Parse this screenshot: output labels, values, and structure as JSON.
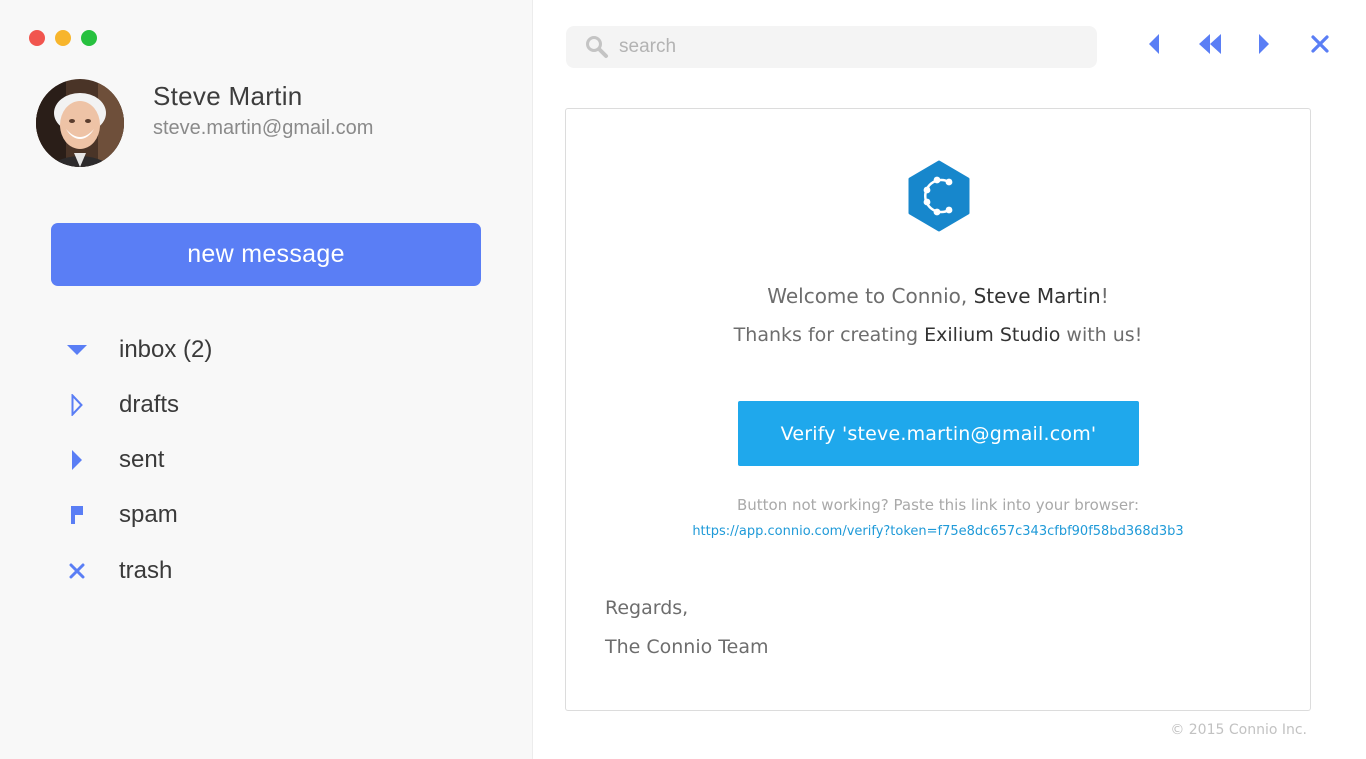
{
  "window": {
    "traffic_lights": [
      "#f1554e",
      "#f7b52c",
      "#27c13f"
    ]
  },
  "user": {
    "name": "Steve Martin",
    "email": "steve.martin@gmail.com"
  },
  "sidebar": {
    "new_message_label": "new message",
    "accent": "#5a7ef5",
    "items": [
      {
        "label": "inbox (2)",
        "icon": "triangle-down-icon"
      },
      {
        "label": "drafts",
        "icon": "triangle-right-outline-icon"
      },
      {
        "label": "sent",
        "icon": "triangle-right-icon"
      },
      {
        "label": "spam",
        "icon": "flag-icon"
      },
      {
        "label": "trash",
        "icon": "x-icon"
      }
    ]
  },
  "search": {
    "placeholder": "search"
  },
  "toolbar": {
    "icons": [
      "reply-icon",
      "reply-all-icon",
      "forward-icon",
      "close-icon"
    ]
  },
  "email": {
    "welcome_prefix": "Welcome to Connio, ",
    "welcome_name": "Steve Martin",
    "welcome_suffix": "!",
    "thanks_prefix": "Thanks for creating ",
    "thanks_studio": "Exilium Studio",
    "thanks_suffix": " with us!",
    "verify_label": "Verify 'steve.martin@gmail.com'",
    "hint": "Button not working? Paste this link into your browser:",
    "link": "https://app.connio.com/verify?token=f75e8dc657c343cfbf90f58bd368d3b3",
    "regards": "Regards,",
    "team": "The Connio Team",
    "brand_color": "#1787cc"
  },
  "footer": {
    "copyright": "©  2015 Connio Inc."
  }
}
